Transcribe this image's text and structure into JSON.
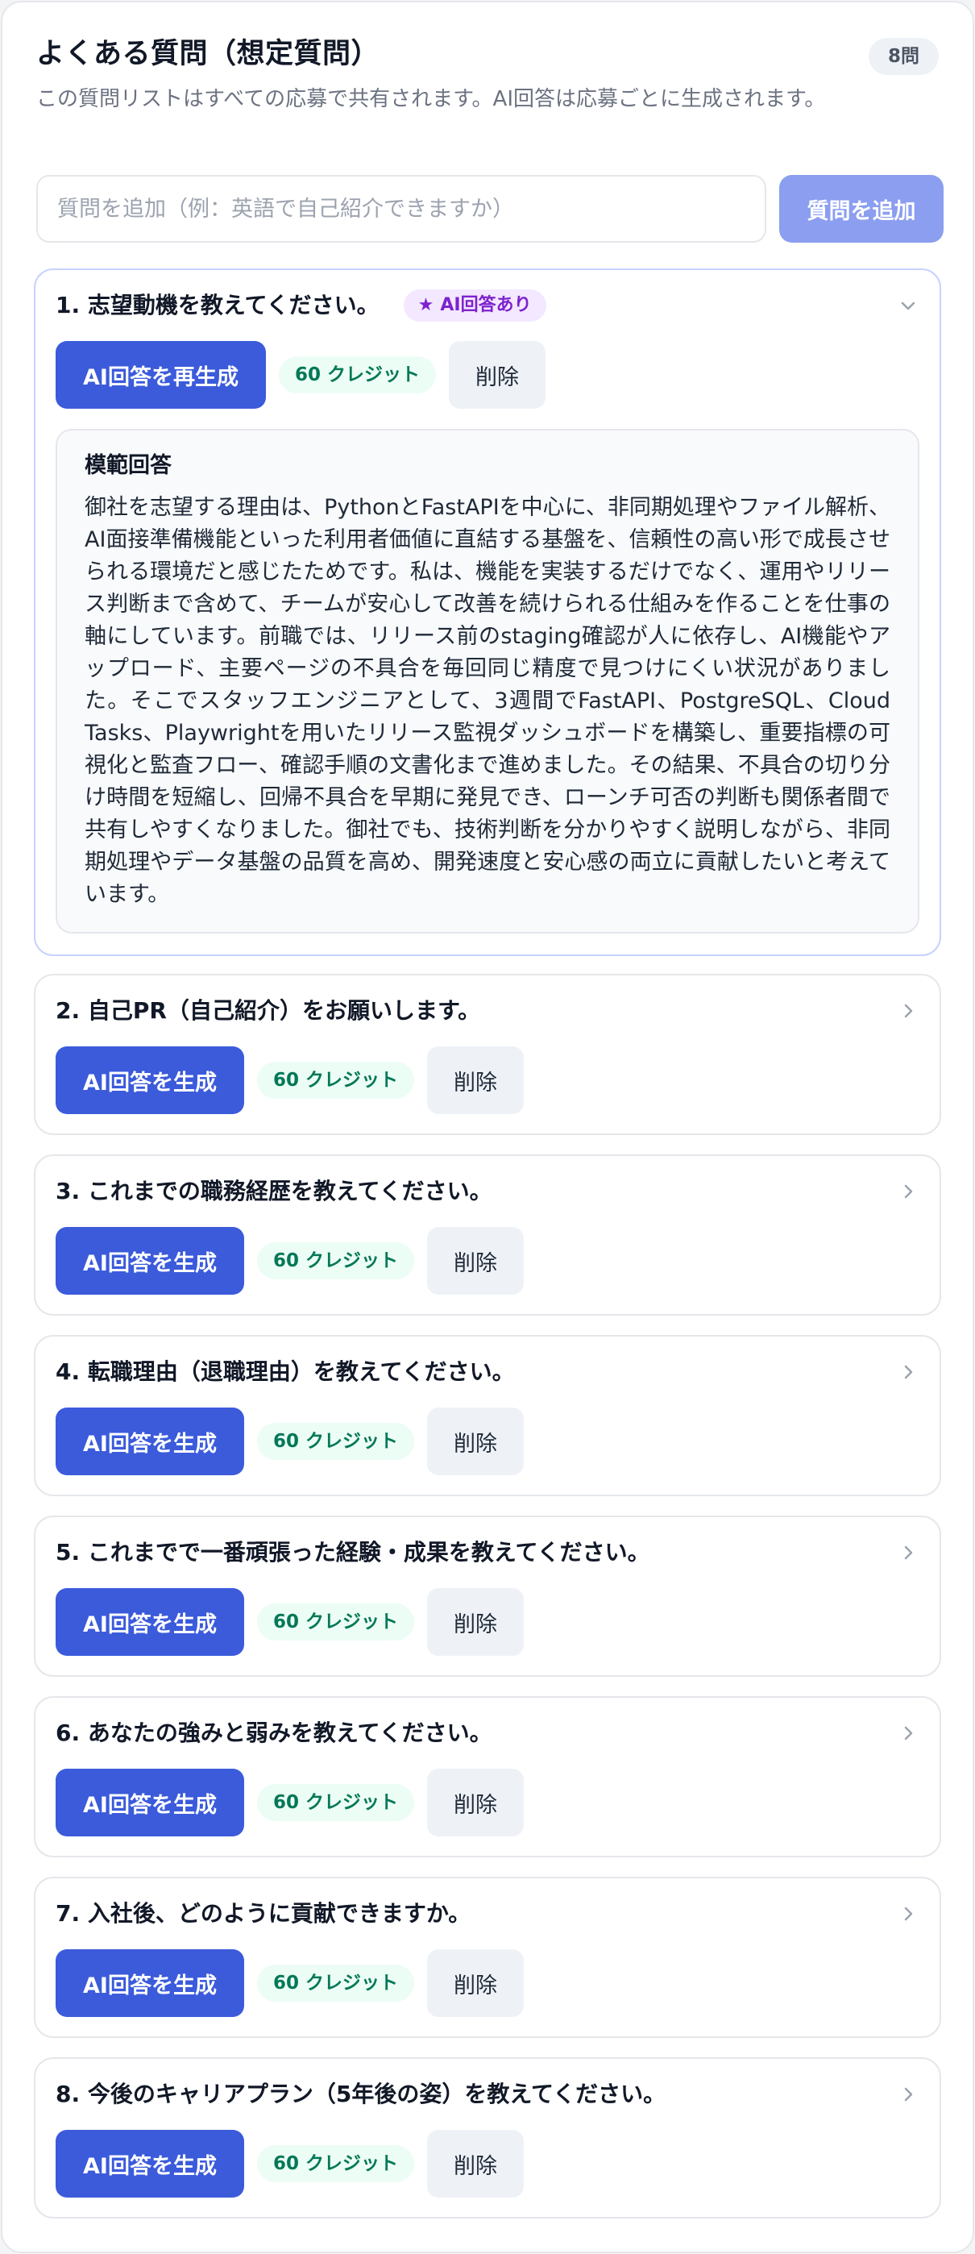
{
  "header": {
    "title": "よくある質問（想定質問）",
    "count_badge": "8問",
    "subtitle": "この質問リストはすべての応募で共有されます。AI回答は応募ごとに生成されます。"
  },
  "add_form": {
    "placeholder": "質問を追加（例：英語で自己紹介できますか）",
    "value": "",
    "button_label": "質問を追加"
  },
  "questions": [
    {
      "text": "1. 志望動機を教えてください。",
      "has_ai_answer": true,
      "ai_badge": "AI回答あり",
      "expanded": true,
      "generate_label": "AI回答を再生成",
      "credit": "60 クレジット",
      "delete_label": "削除",
      "answer_title": "模範回答",
      "answer_body": "御社を志望する理由は、PythonとFastAPIを中心に、非同期処理やファイル解析、AI面接準備機能といった利用者価値に直結する基盤を、信頼性の高い形で成長させられる環境だと感じたためです。私は、機能を実装するだけでなく、運用やリリース判断まで含めて、チームが安心して改善を続けられる仕組みを作ることを仕事の軸にしています。前職では、リリース前のstaging確認が人に依存し、AI機能やアップロード、主要ページの不具合を毎回同じ精度で見つけにくい状況がありました。そこでスタッフエンジニアとして、3週間でFastAPI、PostgreSQL、Cloud Tasks、Playwrightを用いたリリース監視ダッシュボードを構築し、重要指標の可視化と監査フロー、確認手順の文書化まで進めました。その結果、不具合の切り分け時間を短縮し、回帰不具合を早期に発見でき、ローンチ可否の判断も関係者間で共有しやすくなりました。御社でも、技術判断を分かりやすく説明しながら、非同期処理やデータ基盤の品質を高め、開発速度と安心感の両立に貢献したいと考えています。"
    },
    {
      "text": "2. 自己PR（自己紹介）をお願いします。",
      "has_ai_answer": false,
      "expanded": false,
      "generate_label": "AI回答を生成",
      "credit": "60 クレジット",
      "delete_label": "削除"
    },
    {
      "text": "3. これまでの職務経歴を教えてください。",
      "has_ai_answer": false,
      "expanded": false,
      "generate_label": "AI回答を生成",
      "credit": "60 クレジット",
      "delete_label": "削除"
    },
    {
      "text": "4. 転職理由（退職理由）を教えてください。",
      "has_ai_answer": false,
      "expanded": false,
      "generate_label": "AI回答を生成",
      "credit": "60 クレジット",
      "delete_label": "削除"
    },
    {
      "text": "5. これまでで一番頑張った経験・成果を教えてください。",
      "has_ai_answer": false,
      "expanded": false,
      "generate_label": "AI回答を生成",
      "credit": "60 クレジット",
      "delete_label": "削除"
    },
    {
      "text": "6. あなたの強みと弱みを教えてください。",
      "has_ai_answer": false,
      "expanded": false,
      "generate_label": "AI回答を生成",
      "credit": "60 クレジット",
      "delete_label": "削除"
    },
    {
      "text": "7. 入社後、どのように貢献できますか。",
      "has_ai_answer": false,
      "expanded": false,
      "generate_label": "AI回答を生成",
      "credit": "60 クレジット",
      "delete_label": "削除"
    },
    {
      "text": "8. 今後のキャリアプラン（5年後の姿）を教えてください。",
      "has_ai_answer": false,
      "expanded": false,
      "generate_label": "AI回答を生成",
      "credit": "60 クレジット",
      "delete_label": "削除"
    }
  ],
  "colors": {
    "primary": "#3b5bdb",
    "primary_disabled": "#8b9ef0",
    "credit_text": "#047857",
    "credit_bg": "#ecfdf5",
    "ai_badge_text": "#7e22ce",
    "ai_badge_bg": "#f3e8ff"
  },
  "icons": {
    "expanded": "chevron-down-icon",
    "collapsed": "chevron-right-icon",
    "ai_badge": "star-icon"
  }
}
